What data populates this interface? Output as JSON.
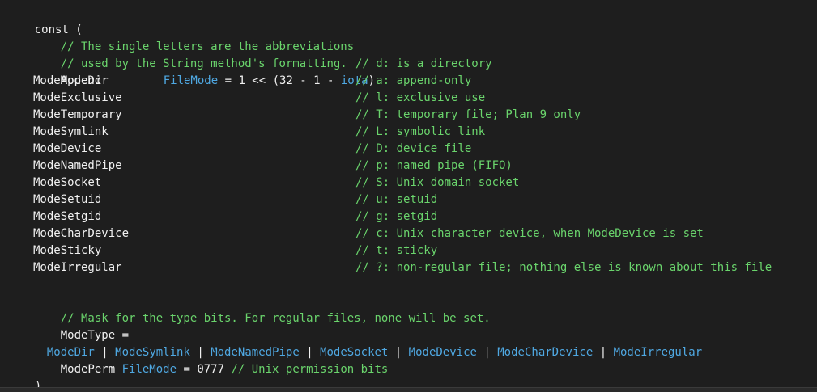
{
  "code": {
    "open": "const (",
    "close": ")",
    "header_comment_1": "// The single letters are the abbreviations",
    "header_comment_2": "// used by the String method's formatting.",
    "first_const": {
      "name": "ModeDir",
      "type": "FileMode",
      "expr_a": " = 1 << (32 - 1 - ",
      "iota": "iota",
      "expr_b": ")",
      "comment": "// d: is a directory"
    },
    "constants": [
      {
        "name": "ModeAppend",
        "comment": "// a: append-only"
      },
      {
        "name": "ModeExclusive",
        "comment": "// l: exclusive use"
      },
      {
        "name": "ModeTemporary",
        "comment": "// T: temporary file; Plan 9 only"
      },
      {
        "name": "ModeSymlink",
        "comment": "// L: symbolic link"
      },
      {
        "name": "ModeDevice",
        "comment": "// D: device file"
      },
      {
        "name": "ModeNamedPipe",
        "comment": "// p: named pipe (FIFO)"
      },
      {
        "name": "ModeSocket",
        "comment": "// S: Unix domain socket"
      },
      {
        "name": "ModeSetuid",
        "comment": "// u: setuid"
      },
      {
        "name": "ModeSetgid",
        "comment": "// g: setgid"
      },
      {
        "name": "ModeCharDevice",
        "comment": "// c: Unix character device, when ModeDevice is set"
      },
      {
        "name": "ModeSticky",
        "comment": "// t: sticky"
      },
      {
        "name": "ModeIrregular",
        "comment": "// ?: non-regular file; nothing else is known about this file"
      }
    ],
    "mask_comment": "// Mask for the type bits. For regular files, none will be set.",
    "mode_type": {
      "name": "ModeType",
      "eq": " = ",
      "sep": " | ",
      "parts": [
        "ModeDir",
        "ModeSymlink",
        "ModeNamedPipe",
        "ModeSocket",
        "ModeDevice",
        "ModeCharDevice",
        "ModeIrregular"
      ]
    },
    "mode_perm": {
      "name": "ModePerm",
      "type": "FileMode",
      "value": " = 0777 ",
      "comment": "// Unix permission bits"
    }
  },
  "colors": {
    "background": "#1e1e1e",
    "identifier": "#f0f0f0",
    "comment": "#6ad46c",
    "type": "#4fa8e2"
  }
}
